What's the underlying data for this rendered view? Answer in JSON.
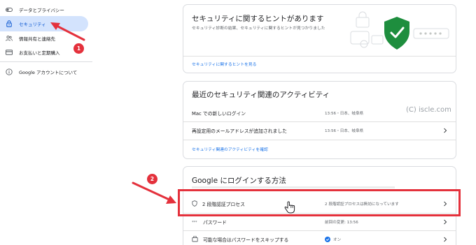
{
  "sidebar": {
    "items": [
      {
        "label": "データとプライバシー",
        "icon": "toggle-icon"
      },
      {
        "label": "セキュリティ",
        "icon": "lock-icon",
        "active": true
      },
      {
        "label": "情報共有と連絡先",
        "icon": "people-icon"
      },
      {
        "label": "お支払いと定期購入",
        "icon": "credit-card-icon"
      },
      {
        "label": "Google アカウントについて",
        "icon": "info-icon"
      }
    ]
  },
  "hints_card": {
    "title": "セキュリティに関するヒントがあります",
    "description": "セキュリティ診断の結果、セキュリティに関するヒントが見つかりました",
    "link": "セキュリティに関するヒントを見る"
  },
  "activity_card": {
    "title": "最近のセキュリティ関連のアクティビティ",
    "rows": [
      {
        "label": "Mac での新しいログイン",
        "meta": "13:56・日本、岐阜県"
      },
      {
        "label": "再設定用のメールアドレスが追加されました",
        "meta": "13:56・日本、岐阜県"
      }
    ],
    "link": "セキュリティ関連のアクティビティを確認"
  },
  "signin_card": {
    "title": "Google にログインする方法",
    "rows": [
      {
        "label": "2 段階認証プロセス",
        "meta": "2 段階認証プロセスは無効になっています",
        "icon": "shield-icon"
      },
      {
        "label": "パスワード",
        "meta": "前回の変更: 13:56",
        "icon": "password-icon"
      },
      {
        "label": "可能な場合はパスワードをスキップする",
        "meta": "オン",
        "icon": "skip-password-icon"
      }
    ]
  },
  "watermark": "(C) iscle.com",
  "annotations": {
    "step1": "1",
    "step2": "2"
  },
  "colors": {
    "accent": "#1a73e8",
    "active_bg": "#d3e3fd",
    "annotation_red": "#e4313c",
    "shield_green": "#1e8e3e"
  }
}
